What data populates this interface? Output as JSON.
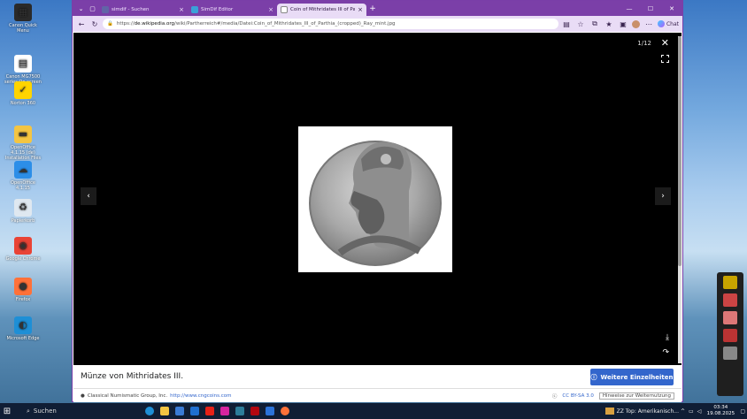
{
  "desktop_icons": [
    {
      "label": "Canon Quick Menu",
      "color": "#2a2a2a",
      "glyph": "▦"
    },
    {
      "label": "Canon MG7500 series On-screen Manual",
      "color": "#ffffff",
      "glyph": "▤"
    },
    {
      "label": "Norton 360",
      "color": "#ffd400",
      "glyph": "✓"
    },
    {
      "label": "OpenOffice 4.1.15 (de) Installation Files",
      "color": "#f4c542",
      "glyph": "▬"
    },
    {
      "label": "OpenOffice 4.1.15",
      "color": "#2c8ee8",
      "glyph": "☁"
    },
    {
      "label": "Papierkorb",
      "color": "#dfe8f0",
      "glyph": "♻"
    },
    {
      "label": "Google Chrome",
      "color": "#e94335",
      "glyph": "◉"
    },
    {
      "label": "Firefox",
      "color": "#ff7139",
      "glyph": "●"
    },
    {
      "label": "Microsoft Edge",
      "color": "#1e8fd6",
      "glyph": "◐"
    }
  ],
  "browser": {
    "tabs": [
      {
        "title": "simdif - Suchen",
        "color": "#6264a7"
      },
      {
        "title": "SimDif Editor",
        "color": "#3aa0d8"
      },
      {
        "title": "Coin of Mithridates III of Parthia (cropped)",
        "color": "#ffffff"
      }
    ],
    "url_prefix": "https://",
    "url_host": "de.wikipedia.org",
    "url_path": "/wiki/Partherreich#/media/Datei:Coin_of_Mithridates_III_of_Parthia_(cropped)_Ray_mint.jpg",
    "chat_label": "Chat"
  },
  "viewer": {
    "counter": "1/12",
    "caption": "Münze von Mithridates III.",
    "more_button": "Weitere Einzelheiten",
    "author": "Classical Numismatic Group, Inc.",
    "author_link": "http://www.cngcoins.com",
    "license": "CC BY-SA 3.0",
    "reuse_link": "Hinweise zur Weiternutzung"
  },
  "taskbar": {
    "search_label": "Suchen",
    "news": "ZZ Top: Amerikanisch...",
    "time": "03:34",
    "date": "19.08.2025"
  },
  "colors": {
    "accent": "#7b3fa8",
    "wiki_blue": "#3366cc"
  }
}
